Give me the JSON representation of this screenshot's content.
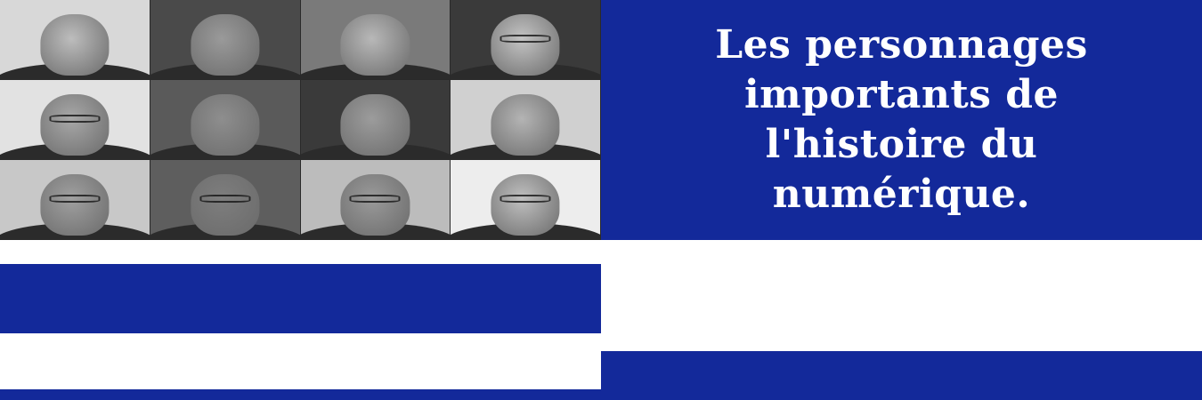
{
  "title": "Les personnages importants de l'histoire du numérique.",
  "colors": {
    "brand_blue": "#13299a",
    "background": "#ffffff",
    "title_text": "#ffffff"
  },
  "portraits": [
    {
      "tone": "#bdbdbd",
      "bg": "#d8d8d8",
      "glasses": false
    },
    {
      "tone": "#9a9a9a",
      "bg": "#4a4a4a",
      "glasses": false
    },
    {
      "tone": "#b8b8b8",
      "bg": "#7a7a7a",
      "glasses": false
    },
    {
      "tone": "#c4c4c4",
      "bg": "#3a3a3a",
      "glasses": true
    },
    {
      "tone": "#a8a8a8",
      "bg": "#e2e2e2",
      "glasses": true
    },
    {
      "tone": "#8e8e8e",
      "bg": "#5a5a5a",
      "glasses": false
    },
    {
      "tone": "#9c9c9c",
      "bg": "#3a3a3a",
      "glasses": false
    },
    {
      "tone": "#b4b4b4",
      "bg": "#d0d0d0",
      "glasses": false
    },
    {
      "tone": "#a0a0a0",
      "bg": "#c8c8c8",
      "glasses": true
    },
    {
      "tone": "#7e7e7e",
      "bg": "#5e5e5e",
      "glasses": true
    },
    {
      "tone": "#9a9a9a",
      "bg": "#bcbcbc",
      "glasses": true
    },
    {
      "tone": "#c0c0c0",
      "bg": "#ededed",
      "glasses": true
    }
  ]
}
